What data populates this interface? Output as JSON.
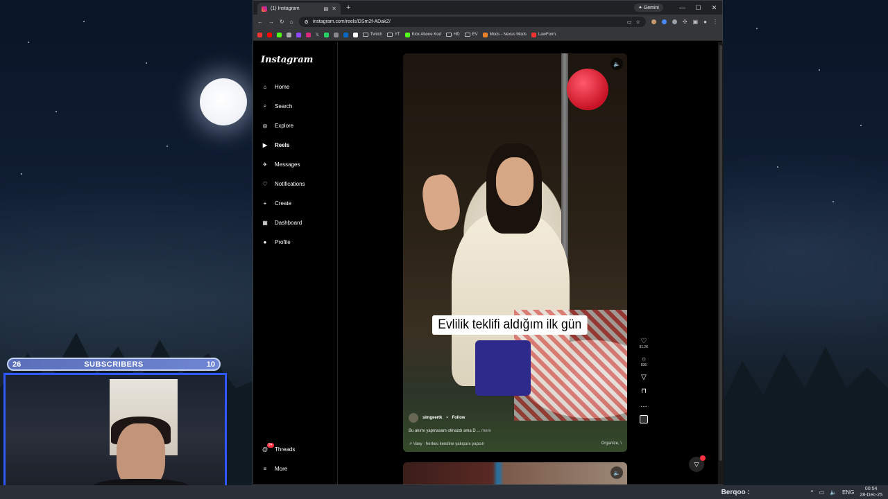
{
  "stream": {
    "subscribers": {
      "left_count": "26",
      "title": "SUBSCRIBERS",
      "right_count": "10"
    },
    "taskbar": {
      "username": "Berqoo :",
      "language": "ENG",
      "time": "00:54",
      "date": "28-Dec-25"
    }
  },
  "browser": {
    "tab_title": "(1) Instagram",
    "gemini_label": "Gemini",
    "url": "instagram.com/reels/DSm2f-ADakZ/",
    "bookmarks": [
      "Twitch",
      "YT",
      "Kick Abone Kod",
      "HD",
      "EV",
      "Mods - Nexus Mods",
      "LawForm"
    ]
  },
  "instagram": {
    "logo": "Instagram",
    "nav": {
      "home": "Home",
      "search": "Search",
      "explore": "Explore",
      "reels": "Reels",
      "messages": "Messages",
      "notifications": "Notifications",
      "create": "Create",
      "dashboard": "Dashboard",
      "profile": "Profile",
      "threads": "Threads",
      "more": "More"
    },
    "threads_badge": "9+",
    "reel": {
      "overlay_text": "Evlilik teklifi aldığım ilk gün",
      "username": "simgeertk",
      "follow": "Follow",
      "description": "Bu akımı yapmasam olmazdı ama D ...",
      "more": "more",
      "audio": "Vaxy · herkes kendine yakışanı yapsın",
      "location": "Organize, \\",
      "likes": "91.2K",
      "comments": "836"
    }
  },
  "colors": {
    "accent": "#2f58ff",
    "badge": "#ff3040",
    "tab_bg": "#35363a"
  }
}
